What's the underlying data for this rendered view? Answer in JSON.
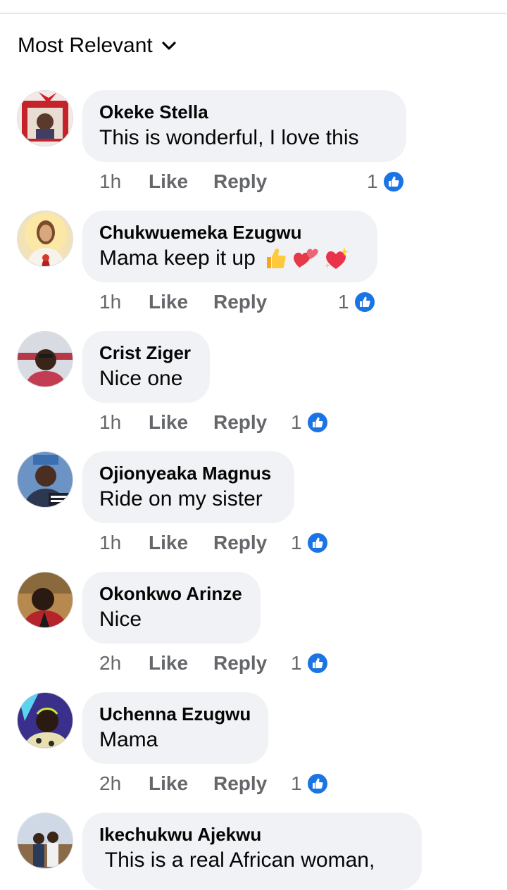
{
  "sort": {
    "label": "Most Relevant"
  },
  "colors": {
    "accent": "#1b74e4",
    "bubble": "#f0f2f5",
    "muted": "#65676b"
  },
  "comments": [
    {
      "author": "Okeke Stella",
      "text": "This is wonderful, I love this",
      "time": "1h",
      "like_label": "Like",
      "reply_label": "Reply",
      "reaction_count": "1",
      "emojis": []
    },
    {
      "author": "Chukwuemeka Ezugwu",
      "text": "Mama keep it up",
      "time": "1h",
      "like_label": "Like",
      "reply_label": "Reply",
      "reaction_count": "1",
      "emojis": [
        "thumbs-up-icon",
        "two-hearts-icon",
        "sparkling-heart-icon"
      ]
    },
    {
      "author": "Crist Ziger",
      "text": "Nice one",
      "time": "1h",
      "like_label": "Like",
      "reply_label": "Reply",
      "reaction_count": "1",
      "emojis": []
    },
    {
      "author": "Ojionyeaka Magnus",
      "text": "Ride on my sister",
      "time": "1h",
      "like_label": "Like",
      "reply_label": "Reply",
      "reaction_count": "1",
      "emojis": []
    },
    {
      "author": "Okonkwo Arinze",
      "text": "Nice",
      "time": "2h",
      "like_label": "Like",
      "reply_label": "Reply",
      "reaction_count": "1",
      "emojis": []
    },
    {
      "author": "Uchenna Ezugwu",
      "text": "Mama",
      "time": "2h",
      "like_label": "Like",
      "reply_label": "Reply",
      "reaction_count": "1",
      "emojis": []
    },
    {
      "author": "Ikechukwu Ajekwu",
      "text": " This is a real African woman,",
      "time": "",
      "like_label": "",
      "reply_label": "",
      "reaction_count": "",
      "emojis": []
    }
  ]
}
